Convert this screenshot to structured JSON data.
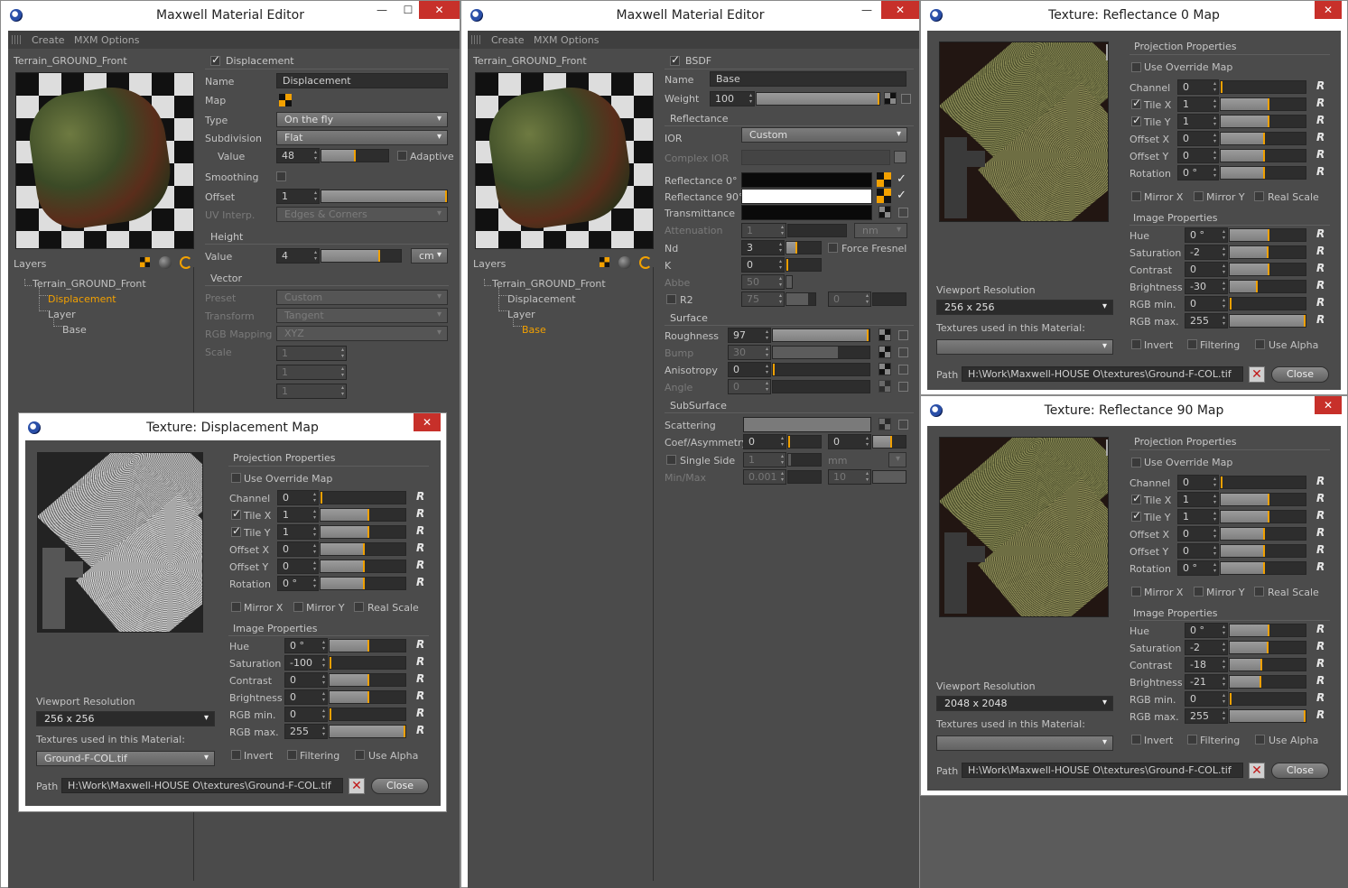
{
  "editor1": {
    "title": "Maxwell Material Editor",
    "menu": [
      "Create",
      "MXM Options"
    ],
    "material": "Terrain_GROUND_Front",
    "layers_label": "Layers",
    "tree": [
      "Terrain_GROUND_Front",
      "Displacement",
      "Layer",
      "Base"
    ],
    "section": "Displacement",
    "name_label": "Name",
    "name_value": "Displacement",
    "map_label": "Map",
    "type_label": "Type",
    "type_value": "On the fly",
    "subdiv_label": "Subdivision",
    "subdiv_value": "Flat",
    "value_label": "Value",
    "value_value": "48",
    "adaptive_label": "Adaptive",
    "smoothing_label": "Smoothing",
    "offset_label": "Offset",
    "offset_value": "1",
    "uv_label": "UV Interp.",
    "uv_value": "Edges & Corners",
    "height_section": "Height",
    "height_value_label": "Value",
    "height_value": "4",
    "height_unit": "cm",
    "vector_section": "Vector",
    "preset_label": "Preset",
    "preset_value": "Custom",
    "transform_label": "Transform",
    "transform_value": "Tangent",
    "rgbmap_label": "RGB Mapping",
    "rgbmap_value": "XYZ",
    "scale_label": "Scale",
    "scale_values": [
      "1",
      "1",
      "1"
    ]
  },
  "editor2": {
    "title": "Maxwell Material Editor",
    "menu": [
      "Create",
      "MXM Options"
    ],
    "material": "Terrain_GROUND_Front",
    "layers_label": "Layers",
    "tree": [
      "Terrain_GROUND_Front",
      "Displacement",
      "Layer",
      "Base"
    ],
    "section": "BSDF",
    "name_label": "Name",
    "name_value": "Base",
    "weight_label": "Weight",
    "weight_value": "100",
    "reflectance_section": "Reflectance",
    "ior_label": "IOR",
    "ior_value": "Custom",
    "complex_ior_label": "Complex IOR",
    "refl0_label": "Reflectance 0°",
    "refl90_label": "Reflectance 90°",
    "trans_label": "Transmittance",
    "atten_label": "Attenuation",
    "atten_value": "1",
    "atten_unit": "nm",
    "nd_label": "Nd",
    "nd_value": "3",
    "force_fresnel_label": "Force Fresnel",
    "k_label": "K",
    "k_value": "0",
    "abbe_label": "Abbe",
    "abbe_value": "50",
    "r2_label": "R2",
    "r2_value1": "75",
    "r2_value2": "0",
    "surface_section": "Surface",
    "roughness_label": "Roughness",
    "roughness_value": "97",
    "bump_label": "Bump",
    "bump_value": "30",
    "aniso_label": "Anisotropy",
    "aniso_value": "0",
    "angle_label": "Angle",
    "angle_value": "0",
    "subsurface_section": "SubSurface",
    "scattering_label": "Scattering",
    "coef_label": "Coef/Asymmetry",
    "coef_value1": "0",
    "coef_value2": "0",
    "single_side_label": "Single Side",
    "single_side_value": "1",
    "single_side_unit": "mm",
    "minmax_label": "Min/Max",
    "min_value": "0.001",
    "max_value": "10"
  },
  "tex_disp": {
    "title": "Texture: Displacement Map",
    "viewport_label": "Viewport Resolution",
    "viewport_value": "256 x 256",
    "used_label": "Textures used in this Material:",
    "used_value": "Ground-F-COL.tif",
    "path_label": "Path",
    "path_value": "H:\\Work\\Maxwell-HOUSE O\\textures\\Ground-F-COL.tif",
    "close_label": "Close",
    "proj_section": "Projection Properties",
    "override_label": "Use Override Map",
    "channel": "0",
    "tile_x": "1",
    "tile_y": "1",
    "offset_x": "0",
    "offset_y": "0",
    "rotation": "0 °",
    "img_section": "Image Properties",
    "hue": "0 °",
    "saturation": "-100",
    "contrast": "0",
    "brightness": "0",
    "rgb_min": "0",
    "rgb_max": "255"
  },
  "tex_r0": {
    "title": "Texture: Reflectance 0 Map",
    "viewport_label": "Viewport Resolution",
    "viewport_value": "256 x 256",
    "used_label": "Textures used in this Material:",
    "used_value": "",
    "path_label": "Path",
    "path_value": "H:\\Work\\Maxwell-HOUSE O\\textures\\Ground-F-COL.tif",
    "close_label": "Close",
    "proj_section": "Projection Properties",
    "override_label": "Use Override Map",
    "channel": "0",
    "tile_x": "1",
    "tile_y": "1",
    "offset_x": "0",
    "offset_y": "0",
    "rotation": "0 °",
    "img_section": "Image Properties",
    "hue": "0 °",
    "saturation": "-2",
    "contrast": "0",
    "brightness": "-30",
    "rgb_min": "0",
    "rgb_max": "255"
  },
  "tex_r90": {
    "title": "Texture: Reflectance 90 Map",
    "viewport_label": "Viewport Resolution",
    "viewport_value": "2048 x 2048",
    "used_label": "Textures used in this Material:",
    "used_value": "",
    "path_label": "Path",
    "path_value": "H:\\Work\\Maxwell-HOUSE O\\textures\\Ground-F-COL.tif",
    "close_label": "Close",
    "proj_section": "Projection Properties",
    "override_label": "Use Override Map",
    "channel": "0",
    "tile_x": "1",
    "tile_y": "1",
    "offset_x": "0",
    "offset_y": "0",
    "rotation": "0 °",
    "img_section": "Image Properties",
    "hue": "0 °",
    "saturation": "-2",
    "contrast": "-18",
    "brightness": "-21",
    "rgb_min": "0",
    "rgb_max": "255"
  },
  "tex_labels": {
    "channel": "Channel",
    "tile_x": "Tile X",
    "tile_y": "Tile Y",
    "offset_x": "Offset X",
    "offset_y": "Offset Y",
    "rotation": "Rotation",
    "mirror_x": "Mirror X",
    "mirror_y": "Mirror Y",
    "real_scale": "Real Scale",
    "hue": "Hue",
    "saturation": "Saturation",
    "contrast": "Contrast",
    "brightness": "Brightness",
    "rgb_min": "RGB min.",
    "rgb_max": "RGB max.",
    "invert": "Invert",
    "filtering": "Filtering",
    "use_alpha": "Use Alpha",
    "reset_glyph": "R"
  },
  "window_buttons": {
    "minimize": "—",
    "maximize": "☐",
    "close": "✕"
  },
  "colors": {
    "accent": "#f3a100",
    "panel": "#4b4b4b",
    "field": "#2e2e2e",
    "close_red": "#c7302a"
  }
}
